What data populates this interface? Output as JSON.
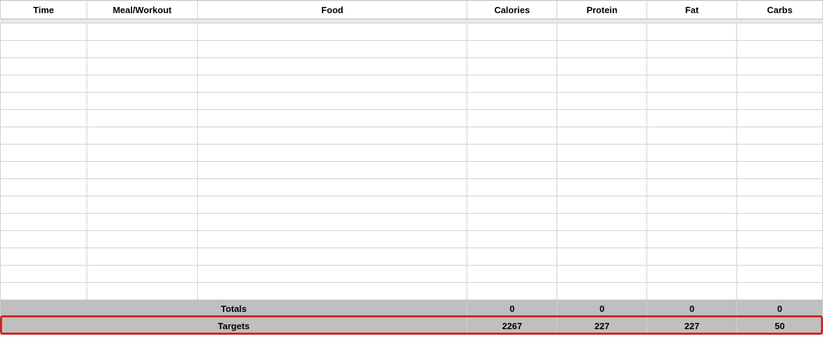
{
  "headers": {
    "time": "Time",
    "meal": "Meal/Workout",
    "food": "Food",
    "calories": "Calories",
    "protein": "Protein",
    "fat": "Fat",
    "carbs": "Carbs"
  },
  "empty_data_rows": 16,
  "totals": {
    "label": "Totals",
    "calories": "0",
    "protein": "0",
    "fat": "0",
    "carbs": "0"
  },
  "targets": {
    "label": "Targets",
    "calories": "2267",
    "protein": "227",
    "fat": "227",
    "carbs": "50"
  }
}
